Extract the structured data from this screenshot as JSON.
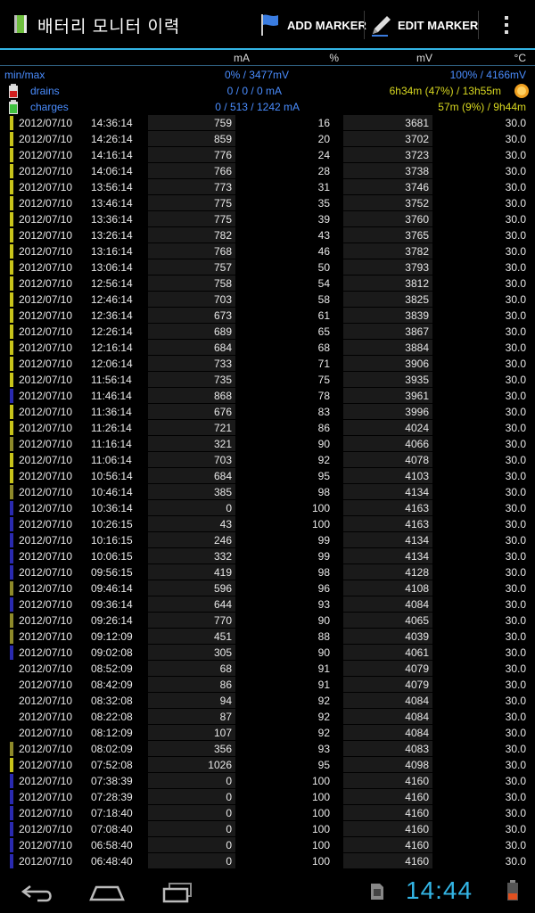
{
  "app": {
    "title": "배터리 모니터 이력"
  },
  "toolbar": {
    "add_marker": "ADD MARKER",
    "edit_marker": "EDIT MARKER"
  },
  "columns": {
    "ma": "mA",
    "pct": "%",
    "mv": "mV",
    "temp": "°C"
  },
  "summary": {
    "minmax_label": "min/max",
    "minmax_low": "0% / 3477mV",
    "minmax_high": "100% / 4166mV",
    "drains_label": "drains",
    "drains_ma": "0 / 0 / 0 mA",
    "drains_time": "6h34m (47%) / 13h55m",
    "charges_label": "charges",
    "charges_ma": "0 / 513 / 1242 mA",
    "charges_time": "57m (9%) / 9h44m"
  },
  "colors": {
    "accent": "#33b5e5",
    "summary_blue": "#4a8dff",
    "summary_yellow": "#d8d820"
  },
  "rows": [
    {
      "date": "2012/07/10",
      "time": "14:36:14",
      "ma": "759",
      "pct": "16",
      "mv": "3681",
      "temp": "30.0",
      "marker": "yellow"
    },
    {
      "date": "2012/07/10",
      "time": "14:26:14",
      "ma": "859",
      "pct": "20",
      "mv": "3702",
      "temp": "30.0",
      "marker": "yellow"
    },
    {
      "date": "2012/07/10",
      "time": "14:16:14",
      "ma": "776",
      "pct": "24",
      "mv": "3723",
      "temp": "30.0",
      "marker": "yellow"
    },
    {
      "date": "2012/07/10",
      "time": "14:06:14",
      "ma": "766",
      "pct": "28",
      "mv": "3738",
      "temp": "30.0",
      "marker": "yellow"
    },
    {
      "date": "2012/07/10",
      "time": "13:56:14",
      "ma": "773",
      "pct": "31",
      "mv": "3746",
      "temp": "30.0",
      "marker": "yellow"
    },
    {
      "date": "2012/07/10",
      "time": "13:46:14",
      "ma": "775",
      "pct": "35",
      "mv": "3752",
      "temp": "30.0",
      "marker": "yellow"
    },
    {
      "date": "2012/07/10",
      "time": "13:36:14",
      "ma": "775",
      "pct": "39",
      "mv": "3760",
      "temp": "30.0",
      "marker": "yellow"
    },
    {
      "date": "2012/07/10",
      "time": "13:26:14",
      "ma": "782",
      "pct": "43",
      "mv": "3765",
      "temp": "30.0",
      "marker": "yellow"
    },
    {
      "date": "2012/07/10",
      "time": "13:16:14",
      "ma": "768",
      "pct": "46",
      "mv": "3782",
      "temp": "30.0",
      "marker": "yellow"
    },
    {
      "date": "2012/07/10",
      "time": "13:06:14",
      "ma": "757",
      "pct": "50",
      "mv": "3793",
      "temp": "30.0",
      "marker": "yellow"
    },
    {
      "date": "2012/07/10",
      "time": "12:56:14",
      "ma": "758",
      "pct": "54",
      "mv": "3812",
      "temp": "30.0",
      "marker": "yellow"
    },
    {
      "date": "2012/07/10",
      "time": "12:46:14",
      "ma": "703",
      "pct": "58",
      "mv": "3825",
      "temp": "30.0",
      "marker": "yellow"
    },
    {
      "date": "2012/07/10",
      "time": "12:36:14",
      "ma": "673",
      "pct": "61",
      "mv": "3839",
      "temp": "30.0",
      "marker": "yellow"
    },
    {
      "date": "2012/07/10",
      "time": "12:26:14",
      "ma": "689",
      "pct": "65",
      "mv": "3867",
      "temp": "30.0",
      "marker": "yellow"
    },
    {
      "date": "2012/07/10",
      "time": "12:16:14",
      "ma": "684",
      "pct": "68",
      "mv": "3884",
      "temp": "30.0",
      "marker": "yellow"
    },
    {
      "date": "2012/07/10",
      "time": "12:06:14",
      "ma": "733",
      "pct": "71",
      "mv": "3906",
      "temp": "30.0",
      "marker": "yellow"
    },
    {
      "date": "2012/07/10",
      "time": "11:56:14",
      "ma": "735",
      "pct": "75",
      "mv": "3935",
      "temp": "30.0",
      "marker": "yellow"
    },
    {
      "date": "2012/07/10",
      "time": "11:46:14",
      "ma": "868",
      "pct": "78",
      "mv": "3961",
      "temp": "30.0",
      "marker": "blue"
    },
    {
      "date": "2012/07/10",
      "time": "11:36:14",
      "ma": "676",
      "pct": "83",
      "mv": "3996",
      "temp": "30.0",
      "marker": "yellow"
    },
    {
      "date": "2012/07/10",
      "time": "11:26:14",
      "ma": "721",
      "pct": "86",
      "mv": "4024",
      "temp": "30.0",
      "marker": "yellow"
    },
    {
      "date": "2012/07/10",
      "time": "11:16:14",
      "ma": "321",
      "pct": "90",
      "mv": "4066",
      "temp": "30.0",
      "marker": "olive"
    },
    {
      "date": "2012/07/10",
      "time": "11:06:14",
      "ma": "703",
      "pct": "92",
      "mv": "4078",
      "temp": "30.0",
      "marker": "yellow"
    },
    {
      "date": "2012/07/10",
      "time": "10:56:14",
      "ma": "684",
      "pct": "95",
      "mv": "4103",
      "temp": "30.0",
      "marker": "yellow"
    },
    {
      "date": "2012/07/10",
      "time": "10:46:14",
      "ma": "385",
      "pct": "98",
      "mv": "4134",
      "temp": "30.0",
      "marker": "olive"
    },
    {
      "date": "2012/07/10",
      "time": "10:36:14",
      "ma": "0",
      "pct": "100",
      "mv": "4163",
      "temp": "30.0",
      "marker": "blue"
    },
    {
      "date": "2012/07/10",
      "time": "10:26:15",
      "ma": "43",
      "pct": "100",
      "mv": "4163",
      "temp": "30.0",
      "marker": "blue"
    },
    {
      "date": "2012/07/10",
      "time": "10:16:15",
      "ma": "246",
      "pct": "99",
      "mv": "4134",
      "temp": "30.0",
      "marker": "blue"
    },
    {
      "date": "2012/07/10",
      "time": "10:06:15",
      "ma": "332",
      "pct": "99",
      "mv": "4134",
      "temp": "30.0",
      "marker": "blue"
    },
    {
      "date": "2012/07/10",
      "time": "09:56:15",
      "ma": "419",
      "pct": "98",
      "mv": "4128",
      "temp": "30.0",
      "marker": "blue"
    },
    {
      "date": "2012/07/10",
      "time": "09:46:14",
      "ma": "596",
      "pct": "96",
      "mv": "4108",
      "temp": "30.0",
      "marker": "olive"
    },
    {
      "date": "2012/07/10",
      "time": "09:36:14",
      "ma": "644",
      "pct": "93",
      "mv": "4084",
      "temp": "30.0",
      "marker": "blue"
    },
    {
      "date": "2012/07/10",
      "time": "09:26:14",
      "ma": "770",
      "pct": "90",
      "mv": "4065",
      "temp": "30.0",
      "marker": "olive"
    },
    {
      "date": "2012/07/10",
      "time": "09:12:09",
      "ma": "451",
      "pct": "88",
      "mv": "4039",
      "temp": "30.0",
      "marker": "olive"
    },
    {
      "date": "2012/07/10",
      "time": "09:02:08",
      "ma": "305",
      "pct": "90",
      "mv": "4061",
      "temp": "30.0",
      "marker": "blue"
    },
    {
      "date": "2012/07/10",
      "time": "08:52:09",
      "ma": "68",
      "pct": "91",
      "mv": "4079",
      "temp": "30.0",
      "marker": "none"
    },
    {
      "date": "2012/07/10",
      "time": "08:42:09",
      "ma": "86",
      "pct": "91",
      "mv": "4079",
      "temp": "30.0",
      "marker": "none"
    },
    {
      "date": "2012/07/10",
      "time": "08:32:08",
      "ma": "94",
      "pct": "92",
      "mv": "4084",
      "temp": "30.0",
      "marker": "none"
    },
    {
      "date": "2012/07/10",
      "time": "08:22:08",
      "ma": "87",
      "pct": "92",
      "mv": "4084",
      "temp": "30.0",
      "marker": "none"
    },
    {
      "date": "2012/07/10",
      "time": "08:12:09",
      "ma": "107",
      "pct": "92",
      "mv": "4084",
      "temp": "30.0",
      "marker": "none"
    },
    {
      "date": "2012/07/10",
      "time": "08:02:09",
      "ma": "356",
      "pct": "93",
      "mv": "4083",
      "temp": "30.0",
      "marker": "olive"
    },
    {
      "date": "2012/07/10",
      "time": "07:52:08",
      "ma": "1026",
      "pct": "95",
      "mv": "4098",
      "temp": "30.0",
      "marker": "yellow"
    },
    {
      "date": "2012/07/10",
      "time": "07:38:39",
      "ma": "0",
      "pct": "100",
      "mv": "4160",
      "temp": "30.0",
      "marker": "blue"
    },
    {
      "date": "2012/07/10",
      "time": "07:28:39",
      "ma": "0",
      "pct": "100",
      "mv": "4160",
      "temp": "30.0",
      "marker": "blue"
    },
    {
      "date": "2012/07/10",
      "time": "07:18:40",
      "ma": "0",
      "pct": "100",
      "mv": "4160",
      "temp": "30.0",
      "marker": "blue"
    },
    {
      "date": "2012/07/10",
      "time": "07:08:40",
      "ma": "0",
      "pct": "100",
      "mv": "4160",
      "temp": "30.0",
      "marker": "blue"
    },
    {
      "date": "2012/07/10",
      "time": "06:58:40",
      "ma": "0",
      "pct": "100",
      "mv": "4160",
      "temp": "30.0",
      "marker": "blue"
    },
    {
      "date": "2012/07/10",
      "time": "06:48:40",
      "ma": "0",
      "pct": "100",
      "mv": "4160",
      "temp": "30.0",
      "marker": "blue"
    }
  ],
  "marker_colors": {
    "yellow": "#c8c41a",
    "olive": "#8e8a2a",
    "blue": "#2a2ab0",
    "none": "transparent"
  },
  "navbar": {
    "clock": "14:44",
    "icons": [
      "back-icon",
      "home-icon",
      "recent-apps-icon",
      "sd-card-icon",
      "battery-icon"
    ]
  }
}
